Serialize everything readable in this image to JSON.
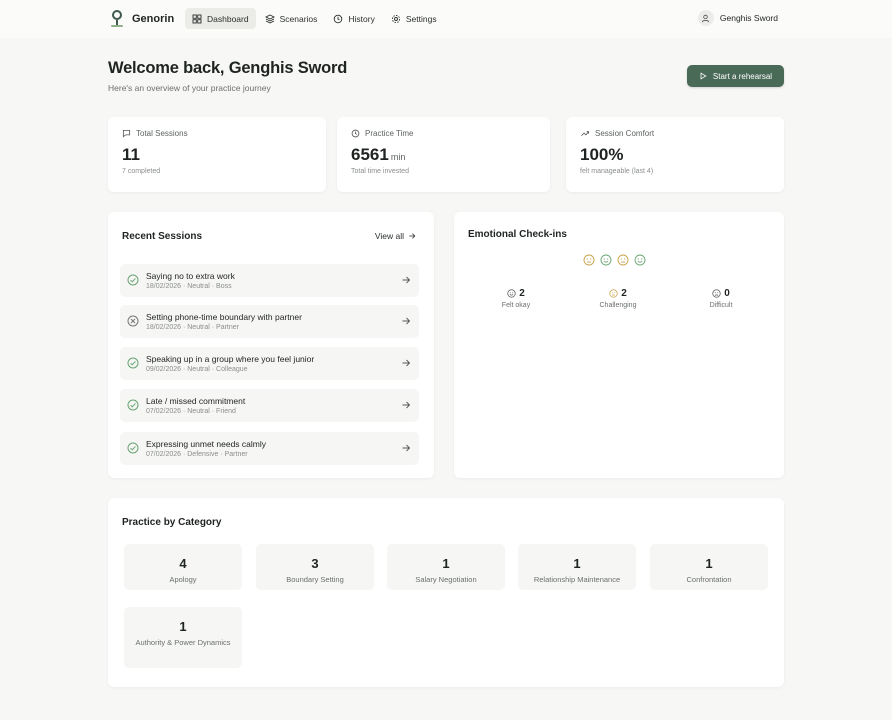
{
  "app": {
    "name": "Genorin"
  },
  "nav": {
    "items": [
      {
        "label": "Dashboard",
        "icon": "grid-icon",
        "active": true
      },
      {
        "label": "Scenarios",
        "icon": "layers-icon",
        "active": false
      },
      {
        "label": "History",
        "icon": "history-icon",
        "active": false
      },
      {
        "label": "Settings",
        "icon": "gear-icon",
        "active": false
      }
    ]
  },
  "user": {
    "name": "Genghis Sword"
  },
  "header": {
    "title": "Welcome back, Genghis Sword",
    "subtitle": "Here's an overview of your practice journey",
    "cta": "Start a rehearsal"
  },
  "stats": [
    {
      "label": "Total Sessions",
      "icon": "chat-icon",
      "value": "11",
      "unit": "",
      "foot": "7 completed"
    },
    {
      "label": "Practice Time",
      "icon": "clock-icon",
      "value": "6561",
      "unit": "min",
      "foot": "Total time invested"
    },
    {
      "label": "Session Comfort",
      "icon": "trend-up-icon",
      "value": "100%",
      "unit": "",
      "foot": "felt manageable (last 4)"
    }
  ],
  "recent": {
    "title": "Recent Sessions",
    "view_all": "View all",
    "items": [
      {
        "title": "Saying no to extra work",
        "meta": "18/02/2026 · Neutral · Boss",
        "status": "completed"
      },
      {
        "title": "Setting phone-time boundary with partner",
        "meta": "18/02/2026 · Neutral · Partner",
        "status": "cancelled"
      },
      {
        "title": "Speaking up in a group where you feel junior",
        "meta": "09/02/2026 · Neutral · Colleague",
        "status": "completed"
      },
      {
        "title": "Late / missed commitment",
        "meta": "07/02/2026 · Neutral · Friend",
        "status": "completed"
      },
      {
        "title": "Expressing unmet needs calmly",
        "meta": "07/02/2026 · Defensive · Partner",
        "status": "completed"
      }
    ]
  },
  "checkins": {
    "title": "Emotional Check-ins",
    "items": [
      {
        "value": "2",
        "label": "Felt okay"
      },
      {
        "value": "2",
        "label": "Challenging"
      },
      {
        "value": "0",
        "label": "Difficult"
      }
    ]
  },
  "categories": {
    "title": "Practice by Category",
    "items": [
      {
        "value": "4",
        "label": "Apology"
      },
      {
        "value": "3",
        "label": "Boundary Setting"
      },
      {
        "value": "1",
        "label": "Salary Negotiation"
      },
      {
        "value": "1",
        "label": "Relationship Maintenance"
      },
      {
        "value": "1",
        "label": "Confrontation"
      },
      {
        "value": "1",
        "label": "Authority & Power Dynamics"
      }
    ]
  },
  "colors": {
    "accent": "#4a6a58",
    "green": "#6aa573",
    "amber": "#c7a24a",
    "red": "#c07a6c"
  }
}
